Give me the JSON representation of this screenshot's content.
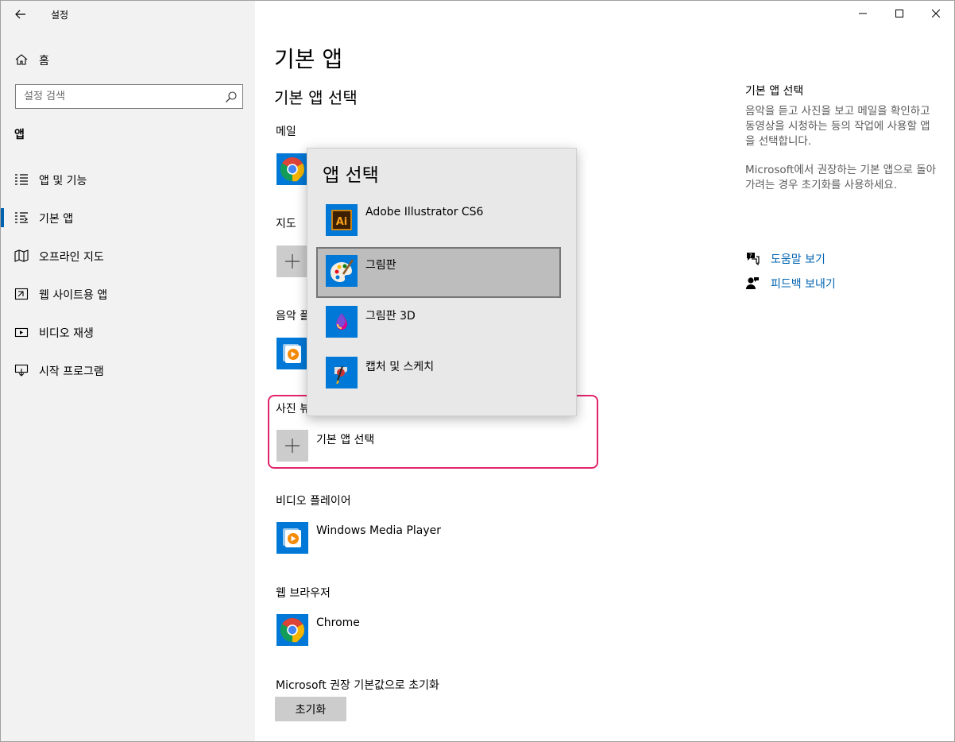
{
  "window": {
    "title": "설정",
    "controls": {
      "minimize": "minimize-icon",
      "maximize": "maximize-icon",
      "close": "close-icon"
    }
  },
  "sidebar": {
    "home": "홈",
    "search_placeholder": "설정 검색",
    "section": "앱",
    "items": [
      {
        "label": "앱 및 기능",
        "icon": "apps-features-icon"
      },
      {
        "label": "기본 앱",
        "icon": "default-apps-icon",
        "active": true
      },
      {
        "label": "오프라인 지도",
        "icon": "offline-maps-icon"
      },
      {
        "label": "웹 사이트용 앱",
        "icon": "apps-for-websites-icon"
      },
      {
        "label": "비디오 재생",
        "icon": "video-playback-icon"
      },
      {
        "label": "시작 프로그램",
        "icon": "startup-icon"
      }
    ]
  },
  "main": {
    "title": "기본 앱",
    "subtitle": "기본 앱 선택",
    "categories": {
      "mail": {
        "label": "메일"
      },
      "maps": {
        "label": "지도"
      },
      "music": {
        "label": "음악 플"
      },
      "photo": {
        "label": "사진 뷰",
        "app": "기본 앱 선택"
      },
      "video": {
        "label": "비디오 플레이어",
        "app": "Windows Media Player"
      },
      "browser": {
        "label": "웹 브라우저",
        "app": "Chrome"
      }
    },
    "reset": {
      "label": "Microsoft 권장 기본값으로 초기화",
      "button": "초기화"
    }
  },
  "right_panel": {
    "title": "기본 앱 선택",
    "desc1": "음악을 듣고 사진을 보고 메일을 확인하고 동영상을 시청하는 등의 작업에 사용할 앱을 선택합니다.",
    "desc2": "Microsoft에서 권장하는 기본 앱으로 돌아가려는 경우 초기화를 사용하세요.",
    "links": [
      {
        "label": "도움말 보기",
        "icon": "help-chat-icon"
      },
      {
        "label": "피드백 보내기",
        "icon": "feedback-icon"
      }
    ]
  },
  "flyout": {
    "title": "앱 선택",
    "items": [
      {
        "label": "Adobe Illustrator CS6",
        "icon": "adobe-illustrator-icon"
      },
      {
        "label": "그림판",
        "icon": "paint-icon",
        "selected": true
      },
      {
        "label": "그림판 3D",
        "icon": "paint-3d-icon"
      },
      {
        "label": "캡처 및 스케치",
        "icon": "snip-sketch-icon"
      }
    ]
  },
  "colors": {
    "accent": "#0063b1",
    "highlight": "#e2246b",
    "tile_blue": "#0078d7"
  }
}
